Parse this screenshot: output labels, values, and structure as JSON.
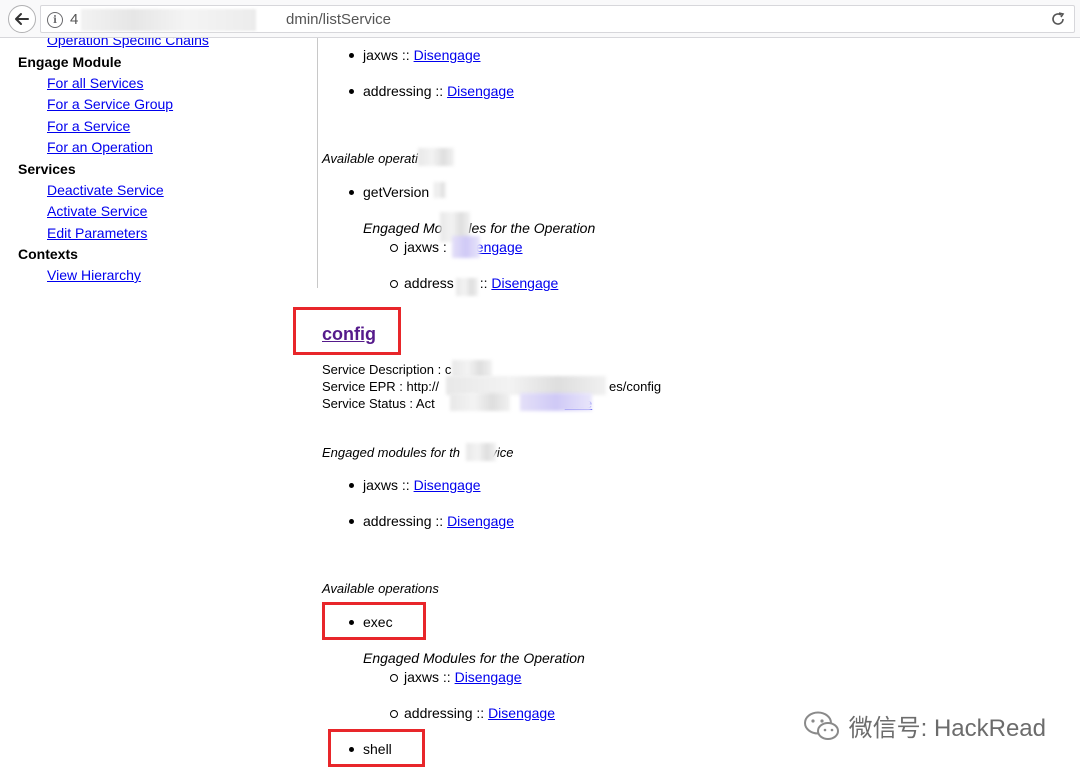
{
  "browser": {
    "url_start": "4",
    "url_end": "dmin/listService"
  },
  "sidebar": {
    "partial_link": "Operation Specific Chains",
    "engage_heading": "Engage Module",
    "engage_items": [
      "For all Services",
      "For a Service Group",
      "For a Service",
      "For an Operation"
    ],
    "services_heading": "Services",
    "services_items": [
      "Deactivate Service",
      "Activate Service",
      "Edit Parameters"
    ],
    "contexts_heading": "Contexts",
    "contexts_items": [
      "View Hierarchy"
    ]
  },
  "prev_service": {
    "modules": [
      {
        "name": "jaxws",
        "sep": " :: ",
        "action": "Disengage"
      },
      {
        "name": "addressing",
        "sep": " :: ",
        "action": "Disengage"
      }
    ],
    "ops_label": "Available operati",
    "operation": "getVersion",
    "op_modules_label_a": "Engaged Mo",
    "op_modules_label_b": "les for the Operation",
    "op_module_1_name": "jaxws :",
    "op_module_1_action": "sengage",
    "op_module_2_name": "address",
    "op_module_2_sep": " :: ",
    "op_module_2_action": "Disengage"
  },
  "config_service": {
    "title": "config",
    "description_label": "Service Description : c",
    "epr_label": "Service EPR : http://",
    "epr_tail": "es/config",
    "status_label": "Service Status : Act",
    "status_link": "rvice",
    "engaged_label_a": "Engaged modules for th",
    "engaged_label_b": "rvice",
    "modules": [
      {
        "name": "jaxws",
        "sep": " :: ",
        "action": "Disengage"
      },
      {
        "name": "addressing",
        "sep": " :: ",
        "action": "Disengage"
      }
    ],
    "ops_label": "Available operations",
    "operations": [
      "exec",
      "shell"
    ],
    "op_modules_label": "Engaged Modules for the Operation",
    "op_modules": [
      {
        "name": "jaxws",
        "sep": " :: ",
        "action": "Disengage"
      },
      {
        "name": "addressing",
        "sep": " :: ",
        "action": "Disengage"
      }
    ]
  },
  "watermark": {
    "text": "微信号: HackRead"
  },
  "colors": {
    "link": "#0000ee",
    "visited": "#551a8b",
    "highlight": "#e8262a"
  }
}
